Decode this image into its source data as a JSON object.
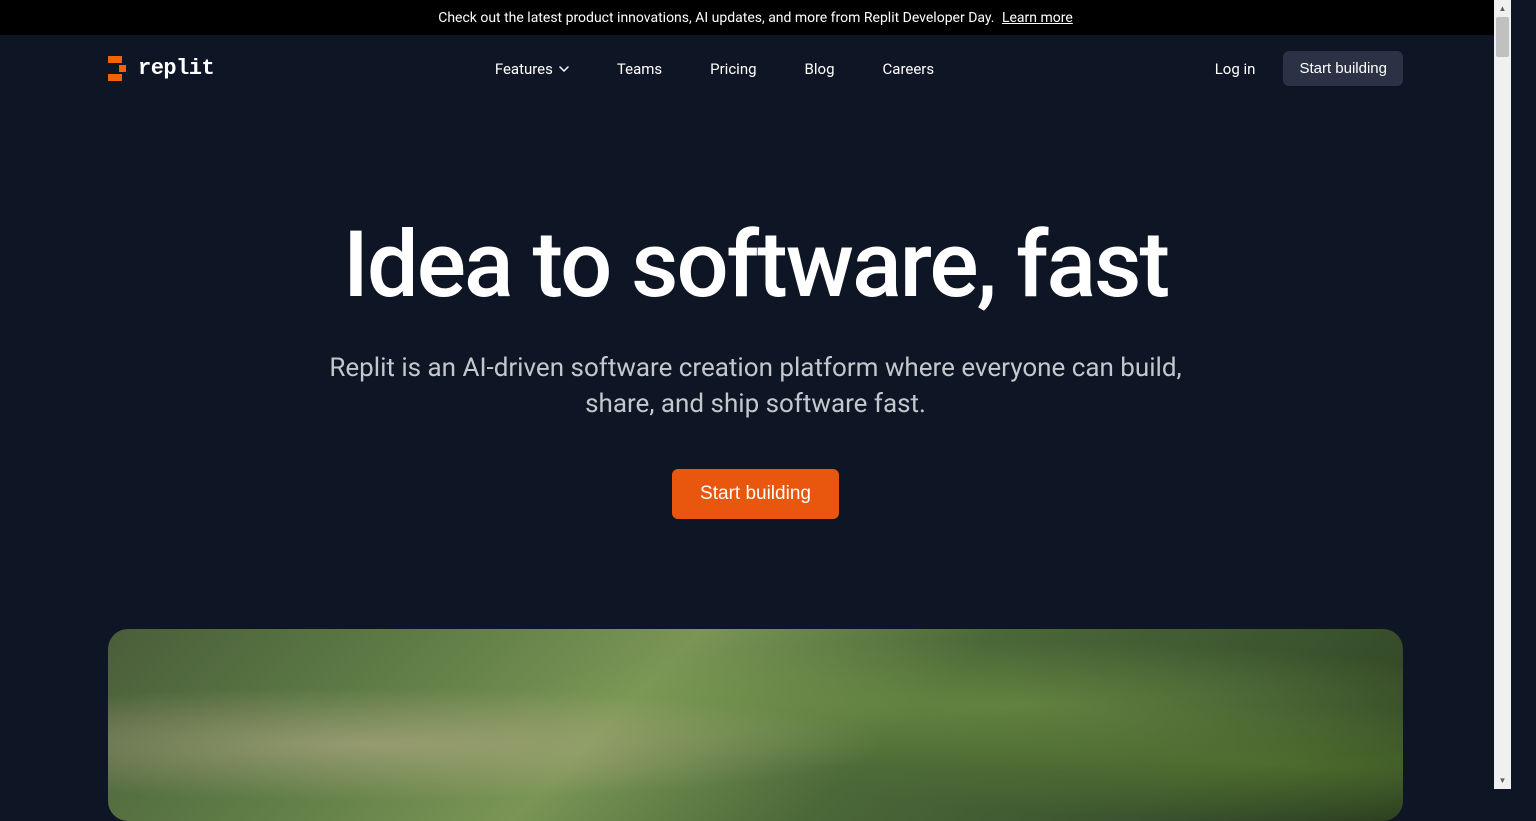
{
  "announcement": {
    "text": "Check out the latest product innovations, AI updates, and more from Replit Developer Day.",
    "link_text": "Learn more"
  },
  "brand": {
    "name": "replit"
  },
  "nav": {
    "items": [
      {
        "label": "Features",
        "has_dropdown": true
      },
      {
        "label": "Teams",
        "has_dropdown": false
      },
      {
        "label": "Pricing",
        "has_dropdown": false
      },
      {
        "label": "Blog",
        "has_dropdown": false
      },
      {
        "label": "Careers",
        "has_dropdown": false
      }
    ],
    "login": "Log in",
    "cta": "Start building"
  },
  "hero": {
    "title": "Idea to software, fast",
    "subtitle_line1": "Replit is an AI-driven software creation platform where everyone can build,",
    "subtitle_line2": "share, and ship software fast.",
    "cta": "Start building"
  }
}
